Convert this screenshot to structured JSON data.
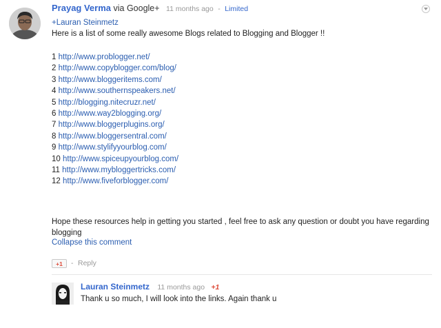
{
  "post": {
    "author": "Prayag Verma",
    "via": "via Google+",
    "timestamp": "11 months ago",
    "separator": "-",
    "visibility": "Limited",
    "mention": "+Lauran Steinmetz",
    "intro": "Here is a list of some really awesome Blogs related to Blogging and Blogger !!",
    "links": [
      {
        "num": "1",
        "url": "http://www.problogger.net/"
      },
      {
        "num": "2",
        "url": "http://www.copyblogger.com/blog/"
      },
      {
        "num": "3",
        "url": "http://www.bloggeritems.com/"
      },
      {
        "num": "4",
        "url": "http://www.southernspeakers.net/"
      },
      {
        "num": "5",
        "url": "http://blogging.nitecruzr.net/"
      },
      {
        "num": "6",
        "url": "http://www.way2blogging.org/"
      },
      {
        "num": "7",
        "url": "http://www.bloggerplugins.org/"
      },
      {
        "num": "8",
        "url": "http://www.bloggersentral.com/"
      },
      {
        "num": "9",
        "url": "http://www.stylifyyourblog.com/"
      },
      {
        "num": "10",
        "url": "http://www.spiceupyourblog.com/"
      },
      {
        "num": "11",
        "url": "http://www.mybloggertricks.com/"
      },
      {
        "num": "12",
        "url": "http://www.fiveforblogger.com/"
      }
    ],
    "closing": "Hope these resources help in getting you started , feel free to ask any question or doubt you have regarding blogging",
    "collapse_label": "Collapse this comment",
    "plus_one_label": "+1",
    "reply_separator": "-",
    "reply_label": "Reply"
  },
  "comment": {
    "author": "Lauran Steinmetz",
    "timestamp": "11 months ago",
    "plus_one": "+1",
    "text": "Thank u so much, I will look into the links. Again thank u"
  },
  "icons": {
    "menu": "chevron-down-icon",
    "avatar": "user-avatar",
    "commenter_avatar": "commenter-avatar"
  },
  "colors": {
    "link": "#2a5db0",
    "author": "#3366cc",
    "plus_one": "#dd4b39",
    "meta": "#999999"
  }
}
